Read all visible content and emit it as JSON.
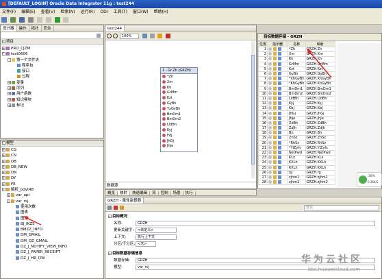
{
  "window": {
    "title": "[DEFAULT_LOGIN] Oracle Data Integrator 11g : test244"
  },
  "menu": [
    "文件(F)",
    "编辑(E)",
    "查看(V)",
    "检索(N)",
    "运行(R)",
    "ODI",
    "工具(T)",
    "窗口(W)",
    "帮助(H)"
  ],
  "left_tabs": {
    "designer": "设计器",
    "operator": "操作",
    "topology": "拓扑",
    "security": "安全"
  },
  "projects": {
    "header": "项目",
    "items": [
      {
        "label": "PRO_CJZM",
        "level": 0,
        "pm": "+",
        "icon": "proj"
      },
      {
        "label": "test0606",
        "level": 0,
        "pm": "-",
        "icon": "proj"
      },
      {
        "label": "第一个文件夹",
        "level": 1,
        "pm": "-",
        "icon": "fold"
      },
      {
        "label": "程序包",
        "level": 2,
        "pm": "",
        "icon": "pkg"
      },
      {
        "label": "接口",
        "level": 2,
        "pm": "",
        "icon": "ifc"
      },
      {
        "label": "过程",
        "level": 2,
        "pm": "",
        "icon": "proc"
      },
      {
        "label": "变量",
        "level": 1,
        "pm": "+",
        "icon": "var"
      },
      {
        "label": "序列",
        "level": 1,
        "pm": "+",
        "icon": "seq"
      },
      {
        "label": "用户函数",
        "level": 1,
        "pm": "+",
        "icon": "fn"
      },
      {
        "label": "知识模块",
        "level": 1,
        "pm": "+",
        "icon": "km"
      },
      {
        "label": "标记",
        "level": 1,
        "pm": "+",
        "icon": "mark"
      }
    ]
  },
  "models": {
    "header": "模型",
    "items": [
      {
        "label": "CG",
        "level": 0
      },
      {
        "label": "CN",
        "level": 0
      },
      {
        "label": "DB",
        "level": 0
      },
      {
        "label": "DB_NEW",
        "level": 0
      },
      {
        "label": "DN",
        "level": 0
      },
      {
        "label": "DY",
        "level": 0
      },
      {
        "label": "FE",
        "level": 0
      },
      {
        "label": "解析_bdyt48",
        "level": 0
      },
      {
        "label": "var_api",
        "level": 1
      },
      {
        "label": "var_rsj",
        "level": 1
      },
      {
        "label": "使用次数",
        "level": 2
      },
      {
        "label": "图表",
        "level": 2
      },
      {
        "label": "图文",
        "level": 2
      },
      {
        "label": "BJ_IKZS",
        "level": 2
      },
      {
        "label": "BMZZ_INFO",
        "level": 2
      },
      {
        "label": "DM_GMAIL",
        "level": 2
      },
      {
        "label": "DM_QZ_GMAIL",
        "level": 2
      },
      {
        "label": "DZ_J_NOTIFY_VIEW_INFO",
        "level": 2
      },
      {
        "label": "DZ_J_PAPER_RECEIPT",
        "level": 2
      },
      {
        "label": "DZ_J_HR_DW",
        "level": 2
      }
    ]
  },
  "editor": {
    "tab": "test244",
    "zoom": "100%",
    "bottom_tabs": [
      "数据源"
    ],
    "footer_tabs": [
      "概览",
      "映射",
      "快速编辑",
      "流",
      "控制",
      "场景",
      "执行"
    ],
    "datastore": {
      "title": "1 - Gr.Zh (GRZH)",
      "columns": [
        "*Zh",
        "Xm",
        "Kh",
        "GrMm",
        "Kzt",
        "GyBh",
        "YxGyBh",
        "BmDm1",
        "BmDm2",
        "LldBh",
        "Kyj",
        "Fdj",
        "JhGj",
        "JhJe"
      ]
    }
  },
  "target": {
    "header": "目标数据存储 - GRZH",
    "col_headers": [
      "位置",
      "指示器",
      "名称",
      "映射"
    ],
    "rows": [
      {
        "pos": "1",
        "name": "*Zh",
        "map": "GRZH.Zh"
      },
      {
        "pos": "2",
        "name": "Xm",
        "map": "GRZH.Xm"
      },
      {
        "pos": "3",
        "name": "Kh",
        "map": "GRZH.Kh"
      },
      {
        "pos": "4",
        "name": "GrMm",
        "map": "GRZH.GrMm"
      },
      {
        "pos": "5",
        "name": "Kzt",
        "map": "GRZH.Kzt"
      },
      {
        "pos": "6",
        "name": "GyBh",
        "map": "GRZH.GyBh"
      },
      {
        "pos": "7",
        "name": "*XhGyBh",
        "map": "GRZH.XhGyBh"
      },
      {
        "pos": "8",
        "name": "*KhGyBh",
        "map": "GRZH.KhGyBh"
      },
      {
        "pos": "9",
        "name": "BmDm1",
        "map": "GRZH.BmDm1"
      },
      {
        "pos": "10",
        "name": "BmDm2",
        "map": "GRZH.BmDm2"
      },
      {
        "pos": "11",
        "name": "LldBh",
        "map": "GRZH.LldBh"
      },
      {
        "pos": "12",
        "name": "Kyj",
        "map": "GRZH.Kyj"
      },
      {
        "pos": "13",
        "name": "Kbj",
        "map": "GRZH.Kbj"
      },
      {
        "pos": "14",
        "name": "JhGj",
        "map": "GRZH.JhGj"
      },
      {
        "pos": "15",
        "name": "JhJe",
        "map": "GRZH.JhJe"
      },
      {
        "pos": "16",
        "name": "ZdBh",
        "map": "GRZH.ZdBh"
      },
      {
        "pos": "17",
        "name": "ZdJh",
        "map": "GRZH.ZdJh"
      },
      {
        "pos": "18",
        "name": "Bh",
        "map": "GRZH.Bh"
      },
      {
        "pos": "19",
        "name": "ZhSz",
        "map": "GRZH.ZhSz"
      },
      {
        "pos": "20",
        "name": "*RhSz",
        "map": "GRZH.RhSz"
      },
      {
        "pos": "21",
        "name": "*YlZyfs",
        "map": "GRZH.YlZyfs"
      },
      {
        "pos": "22",
        "name": "NetPwd",
        "map": "GRZH.NetPwd"
      },
      {
        "pos": "23",
        "name": "KLx",
        "map": "GRZH.KLx"
      },
      {
        "pos": "24",
        "name": "KXLh",
        "map": "GRZH.KXLh"
      },
      {
        "pos": "25",
        "name": "KXLh",
        "map": "GRZH.KXLh"
      },
      {
        "pos": "26",
        "name": "rg",
        "map": "GRZH.rg"
      },
      {
        "pos": "27",
        "name": "zjhm1",
        "map": "GRZH.zjhm1"
      },
      {
        "pos": "28",
        "name": "zjhm2",
        "map": "GRZH.zjhm2"
      }
    ]
  },
  "props": {
    "header": "GRZH - 属性监督器",
    "search_placeholder": "查找",
    "sec1": "目标概况",
    "name_label": "名称:",
    "name_val": "GRZH",
    "upd_label": "更新关键字:",
    "upd_val": "<未定义>",
    "ctx_label": "上下文:",
    "ctx_val": "执行上下文",
    "part_label": "分区/子分区:",
    "part_val": "<无>",
    "sec2": "目标数据存储信息",
    "ds_label": "数据存储:",
    "ds_val": "GRZH",
    "model_label": "模型:",
    "model_val": "var_rsj"
  },
  "tray": {
    "pct": "36%",
    "rate": "0.36K/S"
  },
  "watermark": {
    "cn": "华为云社区",
    "url": "bbs.huaweicloud.com"
  }
}
